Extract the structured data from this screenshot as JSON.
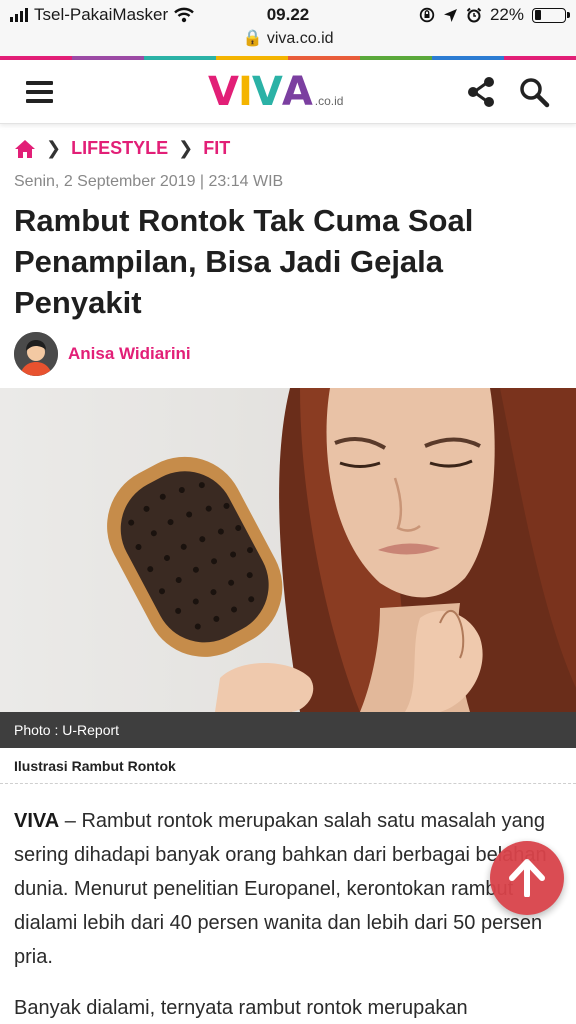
{
  "status_bar": {
    "carrier": "Tsel-PakaiMasker",
    "time": "09.22",
    "url": "viva.co.id",
    "battery": "22%",
    "battery_level": 0.22
  },
  "header": {
    "logo_letters": [
      "V",
      "I",
      "V",
      "A"
    ],
    "logo_suffix": ".co.id",
    "menu_icon": "hamburger-icon",
    "share_icon": "share-icon",
    "search_icon": "search-icon"
  },
  "colors": {
    "accent": "#e21f77",
    "logo_v": "#e21f77",
    "logo_i": "#f4b400",
    "logo_v2": "#2bb2a6",
    "logo_a": "#7b3fa0",
    "fab": "#d9434a"
  },
  "breadcrumb": {
    "home_icon": "home-icon",
    "items": [
      "LIFESTYLE",
      "FIT"
    ]
  },
  "article": {
    "date": "Senin, 2 September 2019 | 23:14 WIB",
    "title": "Rambut Rontok Tak Cuma Soal Penampilan, Bisa Jadi Gejala Penyakit",
    "author": "Anisa Widiarini",
    "photo_credit": "Photo : U-Report",
    "caption": "Ilustrasi Rambut Rontok",
    "lead": "VIVA",
    "paragraph1": " – Rambut rontok merupakan salah satu masalah yang sering dihadapi banyak orang bahkan dari berbagai belahan dunia. Menurut penelitian Europanel, kerontokan rambut dialami lebih dari 40 persen wanita dan lebih dari 50 persen pria.",
    "paragraph2": "Banyak dialami, ternyata rambut rontok merupakan"
  },
  "scroll_top_icon": "arrow-up-icon"
}
